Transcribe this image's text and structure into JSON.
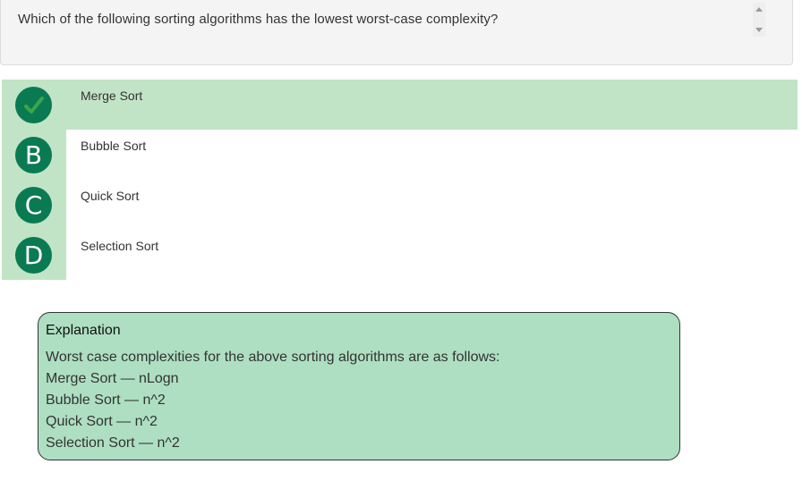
{
  "question": {
    "text": "Which of the following sorting algorithms has the lowest worst-case complexity?"
  },
  "options": [
    {
      "badge": "",
      "label": "Merge Sort",
      "correct": true
    },
    {
      "badge": "B",
      "label": "Bubble Sort",
      "correct": false
    },
    {
      "badge": "C",
      "label": "Quick Sort",
      "correct": false
    },
    {
      "badge": "D",
      "label": "Selection Sort",
      "correct": false
    }
  ],
  "explanation": {
    "title": "Explanation",
    "lines": [
      "Worst case complexities for the above sorting algorithms are as follows:",
      "Merge Sort — nLogn",
      "Bubble Sort — n^2",
      "Quick Sort — n^2",
      "Selection Sort — n^2"
    ]
  },
  "colors": {
    "correct_bg": "#c1e4c6",
    "badge": "#0a7a52",
    "explanation_bg": "#aedfc2"
  }
}
